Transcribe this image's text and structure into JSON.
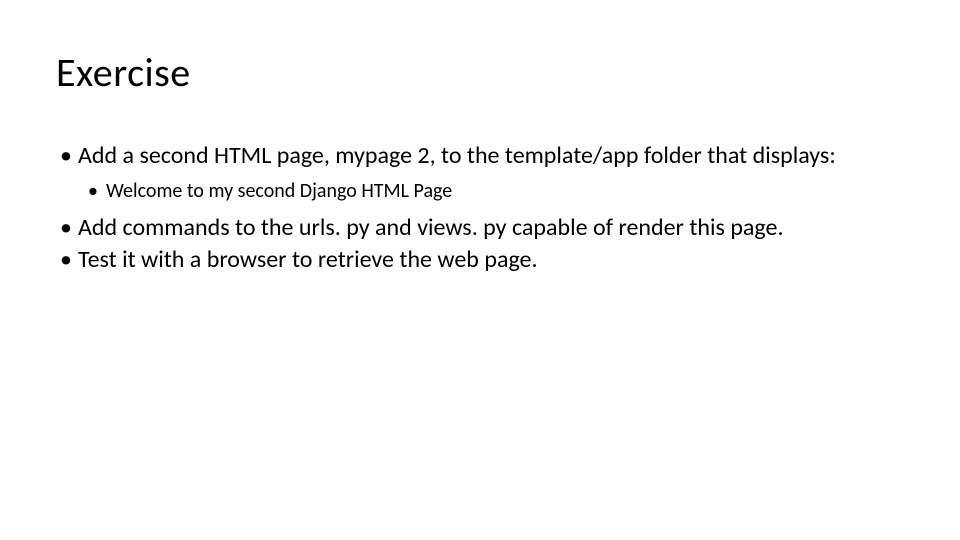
{
  "slide": {
    "title": "Exercise",
    "bullets": [
      {
        "text": "Add a second HTML page, mypage 2, to the template/app folder that displays:",
        "sub": [
          {
            "text": "Welcome to my second Django HTML Page"
          }
        ]
      },
      {
        "text": "Add commands to the urls. py and views. py capable of render this page."
      },
      {
        "text": "Test it with a browser to retrieve the web page."
      }
    ]
  }
}
